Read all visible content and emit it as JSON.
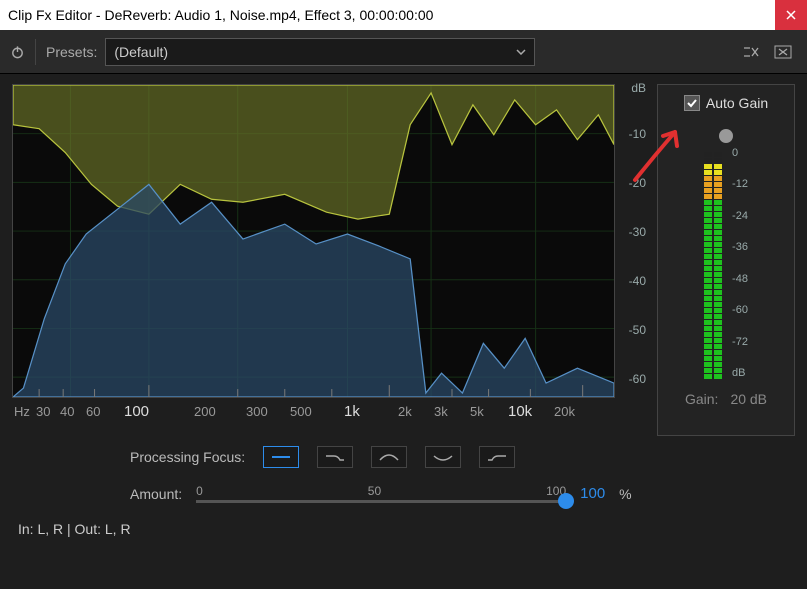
{
  "window": {
    "title": "Clip Fx Editor - DeReverb: Audio 1, Noise.mp4, Effect 3, 00:00:00:00"
  },
  "toolbar": {
    "presets_label": "Presets:",
    "preset_value": "(Default)"
  },
  "spectrum": {
    "db_unit": "dB",
    "db_ticks": [
      "-10",
      "-20",
      "-30",
      "-40",
      "-50",
      "-60"
    ],
    "freq_unit": "Hz",
    "freq_ticks": [
      "30",
      "40",
      "60",
      "100",
      "200",
      "300",
      "500",
      "1k",
      "2k",
      "3k",
      "5k",
      "10k",
      "20k"
    ]
  },
  "autogain": {
    "label": "Auto Gain",
    "checked": true
  },
  "meter": {
    "labels": [
      "0",
      "-12",
      "-24",
      "-36",
      "-48",
      "-60",
      "-72",
      "dB"
    ]
  },
  "gain": {
    "label": "Gain:",
    "value": "20 dB"
  },
  "focus": {
    "label": "Processing Focus:",
    "selected": 0,
    "options": [
      "flat",
      "lowpass",
      "bandpass",
      "notch",
      "highpass"
    ]
  },
  "amount": {
    "label": "Amount:",
    "ticks": [
      "0",
      "50",
      "100"
    ],
    "value": 100,
    "display": "100",
    "unit": "%"
  },
  "io": {
    "text": "In: L, R | Out: L, R"
  },
  "chart_data": {
    "type": "line",
    "title": "",
    "xlabel": "Hz",
    "ylabel": "dB",
    "xscale": "log",
    "xlim": [
      20,
      20000
    ],
    "ylim": [
      -65,
      0
    ],
    "series": [
      {
        "name": "input-spectrum",
        "color": "#a8b13a",
        "x": [
          20,
          50,
          100,
          200,
          400,
          800,
          1000,
          1500,
          2000,
          3000,
          5000,
          10000,
          20000
        ],
        "y": [
          -8,
          -14,
          -20,
          -28,
          -24,
          -26,
          -28,
          -5,
          -4,
          -10,
          -6,
          -8,
          -12
        ]
      },
      {
        "name": "output-spectrum",
        "color": "#4a80b5",
        "x": [
          20,
          50,
          100,
          200,
          400,
          800,
          1000,
          1500,
          2000,
          3000,
          5000,
          10000,
          20000
        ],
        "y": [
          -62,
          -48,
          -26,
          -24,
          -30,
          -32,
          -34,
          -62,
          -60,
          -55,
          -50,
          -62,
          -60
        ]
      }
    ]
  }
}
